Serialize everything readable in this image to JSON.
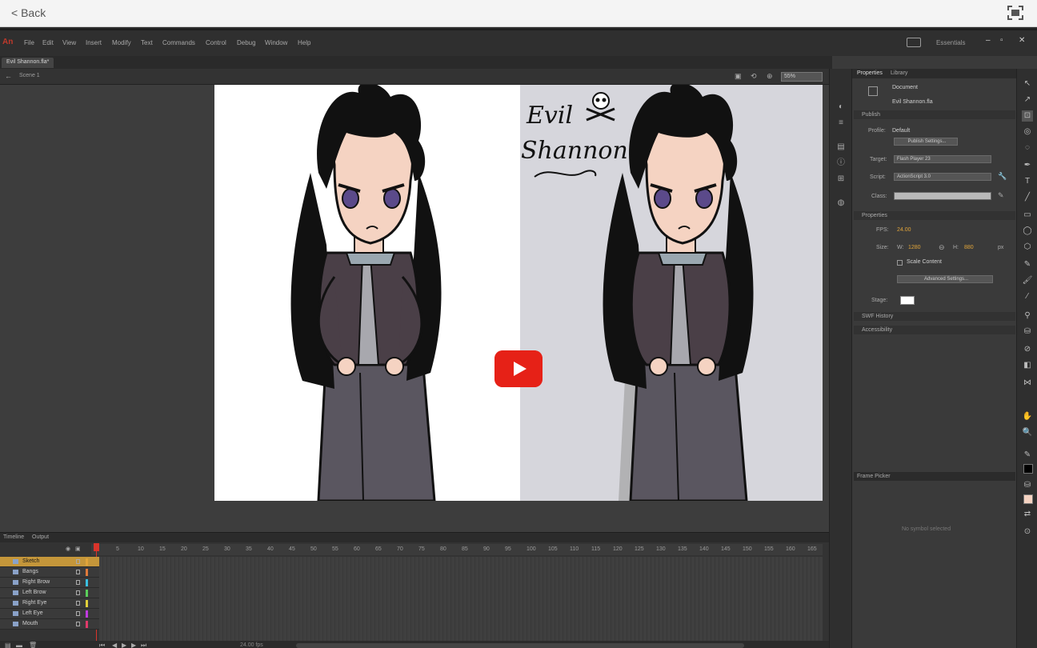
{
  "top": {
    "back_label": "< Back"
  },
  "app": {
    "logo": "An",
    "menus": [
      "File",
      "Edit",
      "View",
      "Insert",
      "Modify",
      "Text",
      "Commands",
      "Control",
      "Debug",
      "Window",
      "Help"
    ],
    "workspace": "Essentials",
    "doc_tab": "Evil Shannon.fla*",
    "scene": "Scene 1",
    "zoom": "55%"
  },
  "artwork": {
    "title_line1": "Evil",
    "title_line2": "Shannon"
  },
  "timeline": {
    "tabs": [
      "Timeline",
      "Output"
    ],
    "frame_numbers": [
      "1",
      "5",
      "10",
      "15",
      "20",
      "25",
      "30",
      "35",
      "40",
      "45",
      "50",
      "55",
      "60",
      "65",
      "70",
      "75",
      "80",
      "85",
      "90",
      "95",
      "100",
      "105",
      "110",
      "115",
      "120",
      "125",
      "130",
      "135",
      "140",
      "145",
      "150",
      "155",
      "160",
      "165"
    ],
    "layers": [
      {
        "name": "Sketch",
        "color": "#e0a43a"
      },
      {
        "name": "Bangs",
        "color": "#e07a3a"
      },
      {
        "name": "Right Brow",
        "color": "#3ac0e0"
      },
      {
        "name": "Left Brow",
        "color": "#5ad05a"
      },
      {
        "name": "Right Eye",
        "color": "#e0d03a"
      },
      {
        "name": "Left Eye",
        "color": "#c03ae0"
      },
      {
        "name": "Mouth",
        "color": "#e03a6a"
      }
    ],
    "fps_readout": "24.00 fps"
  },
  "properties": {
    "tabs": [
      "Properties",
      "Library"
    ],
    "doc_type": "Document",
    "doc_name": "Evil Shannon.fla",
    "publish_section": "Publish",
    "profile_label": "Profile:",
    "profile_value": "Default",
    "publish_settings_button": "Publish Settings...",
    "target_label": "Target:",
    "target_value": "Flash Player 23",
    "script_label": "Script:",
    "script_value": "ActionScript 3.0",
    "class_label": "Class:",
    "properties_section": "Properties",
    "fps_label": "FPS:",
    "fps_value": "24.00",
    "size_label": "Size:",
    "width_label": "W:",
    "width_value": "1280",
    "height_label": "H:",
    "height_value": "880",
    "units": "px",
    "scale_content": "Scale Content",
    "advanced_settings_button": "Advanced Settings...",
    "stage_label": "Stage:",
    "swf_history": "SWF History",
    "accessibility": "Accessibility",
    "frame_picker_title": "Frame Picker",
    "frame_picker_empty": "No symbol selected"
  },
  "colors": {
    "accent": "#e0a43a",
    "play_button": "#e62117",
    "hair": "#111111",
    "jacket": "#4a3f47",
    "pants": "#5a5660",
    "skin": "#f5d3c2",
    "eyes": "#5b4a8a",
    "bg_right": "#d6d6dc"
  }
}
